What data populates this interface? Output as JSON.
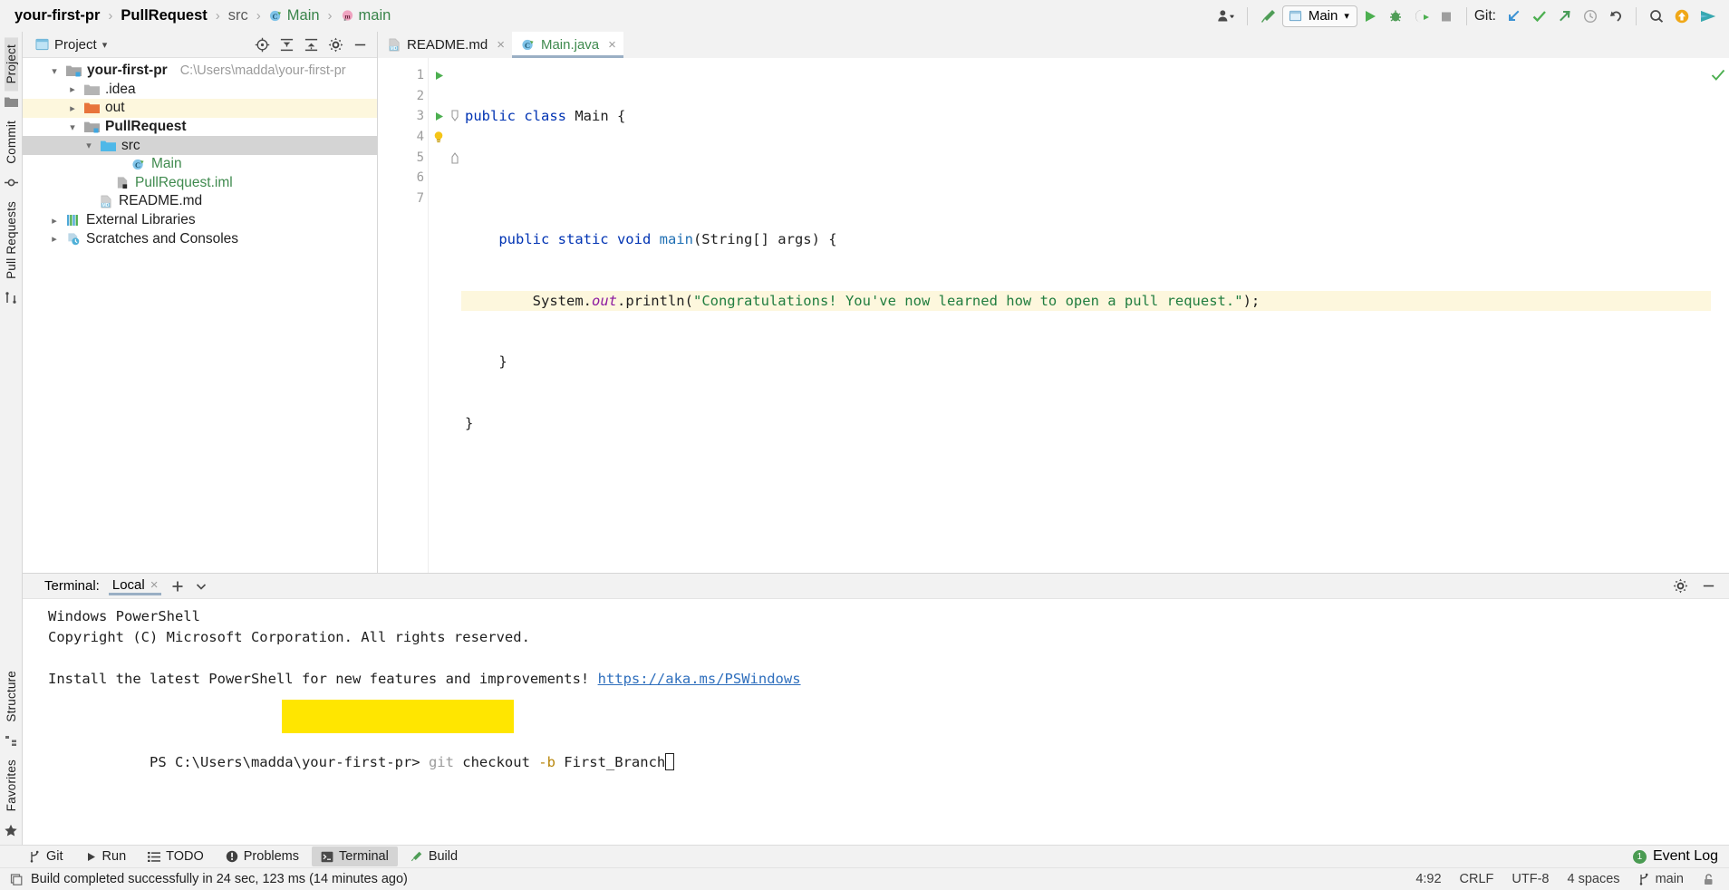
{
  "breadcrumb": {
    "items": [
      {
        "label": "your-first-pr",
        "style": "bold"
      },
      {
        "label": "PullRequest",
        "style": "bold"
      },
      {
        "label": "src",
        "style": "grey"
      },
      {
        "label": "Main",
        "style": "green",
        "icon": "java-class-icon"
      },
      {
        "label": "main",
        "style": "green",
        "icon": "java-method-icon"
      }
    ],
    "separator": "›"
  },
  "toolbar": {
    "account_icon": "user-account-icon",
    "build_icon": "build-hammer-icon",
    "run_config": {
      "label": "Main",
      "icon": "run-config-icon",
      "chevron": "▾"
    },
    "run_icon": "run-play-icon",
    "debug_icon": "debug-bug-icon",
    "run_coverage_icon": "run-with-coverage-icon",
    "stop_icon": "stop-icon",
    "git_label": "Git:",
    "update_project_icon": "git-update-arrow-icon",
    "commit_icon": "git-commit-check-icon",
    "push_icon": "git-push-arrow-icon",
    "history_icon": "git-history-clock-icon",
    "rollback_icon": "git-rollback-undo-icon",
    "search_icon": "search-everywhere-icon",
    "updates_icon": "ide-update-icon",
    "play_services_icon": "run-anything-icon"
  },
  "left_strip": {
    "tabs": [
      {
        "label": "Project",
        "active": true,
        "icon": "project-icon"
      },
      {
        "label": "Commit",
        "active": false,
        "icon": "commit-icon"
      },
      {
        "label": "Pull Requests",
        "active": false,
        "icon": "pull-requests-icon"
      }
    ],
    "bottom_tabs": [
      {
        "label": "Structure",
        "icon": "structure-icon"
      },
      {
        "label": "Favorites",
        "icon": "favorites-star-icon"
      }
    ]
  },
  "project_panel": {
    "title": "Project",
    "title_icon": "project-window-icon",
    "chevron": "▾",
    "tools": [
      {
        "name": "select-opened-file-icon"
      },
      {
        "name": "expand-all-icon"
      },
      {
        "name": "collapse-all-icon"
      },
      {
        "name": "settings-gear-icon"
      },
      {
        "name": "hide-panel-icon"
      }
    ],
    "tree": [
      {
        "label": "your-first-pr",
        "path": "C:\\Users\\madda\\your-first-pr",
        "depth": 0,
        "arrow": "down",
        "icon": "module-folder-icon",
        "bold": true,
        "state": "normal"
      },
      {
        "label": ".idea",
        "path": "",
        "depth": 1,
        "arrow": "right",
        "icon": "folder-grey-icon",
        "bold": false,
        "state": "normal"
      },
      {
        "label": "out",
        "path": "",
        "depth": 1,
        "arrow": "right",
        "icon": "folder-orange-icon",
        "bold": false,
        "state": "highlight"
      },
      {
        "label": "PullRequest",
        "path": "",
        "depth": 1,
        "arrow": "down",
        "icon": "module-folder-icon",
        "bold": true,
        "state": "normal"
      },
      {
        "label": "src",
        "path": "",
        "depth": 2,
        "arrow": "down",
        "icon": "folder-blue-icon",
        "bold": false,
        "state": "selected"
      },
      {
        "label": "Main",
        "path": "",
        "depth": 3,
        "arrow": "none",
        "icon": "java-class-icon",
        "bold": false,
        "state": "normal",
        "green": true
      },
      {
        "label": "PullRequest.iml",
        "path": "",
        "depth": 2,
        "arrow": "none",
        "icon": "iml-file-icon",
        "bold": false,
        "state": "normal",
        "green": true
      },
      {
        "label": "README.md",
        "path": "",
        "depth": 1,
        "arrow": "none",
        "icon": "markdown-file-icon",
        "bold": false,
        "state": "normal"
      },
      {
        "label": "External Libraries",
        "path": "",
        "depth": 0,
        "arrow": "right",
        "icon": "external-libraries-icon",
        "bold": false,
        "state": "normal"
      },
      {
        "label": "Scratches and Consoles",
        "path": "",
        "depth": 0,
        "arrow": "right",
        "icon": "scratches-icon",
        "bold": false,
        "state": "normal"
      }
    ]
  },
  "editor": {
    "tabs": [
      {
        "label": "README.md",
        "icon": "markdown-file-icon",
        "active": false,
        "close": "×",
        "green": false
      },
      {
        "label": "Main.java",
        "icon": "java-class-icon",
        "active": true,
        "close": "×",
        "green": true
      }
    ],
    "lines": [
      {
        "num": "1",
        "gutter_icon": "run-gutter-icon",
        "fold": "none",
        "highlight": false,
        "tokens": [
          {
            "t": "public ",
            "c": "kw"
          },
          {
            "t": "class ",
            "c": "kw"
          },
          {
            "t": "Main {",
            "c": "pl"
          }
        ]
      },
      {
        "num": "2",
        "gutter_icon": "none",
        "fold": "none",
        "highlight": false,
        "tokens": []
      },
      {
        "num": "3",
        "gutter_icon": "run-gutter-icon",
        "fold": "start",
        "highlight": false,
        "tokens": [
          {
            "t": "    public static void ",
            "c": "kw"
          },
          {
            "t": "main",
            "c": "tp"
          },
          {
            "t": "(String[] args) {",
            "c": "pl"
          }
        ]
      },
      {
        "num": "4",
        "gutter_icon": "intention-bulb-icon",
        "fold": "none",
        "highlight": true,
        "tokens": [
          {
            "t": "        System.",
            "c": "pl"
          },
          {
            "t": "out",
            "c": "fd"
          },
          {
            "t": ".println(",
            "c": "pl"
          },
          {
            "t": "\"Congratulations! You've now learned how to open a pull request.\"",
            "c": "st"
          },
          {
            "t": ");",
            "c": "pl"
          }
        ]
      },
      {
        "num": "5",
        "gutter_icon": "none",
        "fold": "end",
        "highlight": false,
        "tokens": [
          {
            "t": "    }",
            "c": "pl"
          }
        ]
      },
      {
        "num": "6",
        "gutter_icon": "none",
        "fold": "none",
        "highlight": false,
        "tokens": [
          {
            "t": "}",
            "c": "pl"
          }
        ]
      },
      {
        "num": "7",
        "gutter_icon": "none",
        "fold": "none",
        "highlight": false,
        "tokens": []
      }
    ],
    "inspection_status_icon": "inspections-ok-check-icon"
  },
  "terminal": {
    "label": "Terminal:",
    "tab_label": "Local",
    "tab_close": "×",
    "add_icon": "add-terminal-tab-icon",
    "chevron_icon": "terminal-tabs-dropdown-icon",
    "settings_icon": "settings-gear-icon",
    "hide_icon": "hide-panel-icon",
    "lines": [
      "Windows PowerShell",
      "Copyright (C) Microsoft Corporation. All rights reserved.",
      "",
      "Install the latest PowerShell for new features and improvements!"
    ],
    "link_text": "https://aka.ms/PSWindows",
    "prompt": "PS C:\\Users\\madda\\your-first-pr>",
    "command_dim": " git",
    "command": " checkout ",
    "command_flag": "-b",
    "command_arg": " First_Branch",
    "highlight_color": "#ffe600"
  },
  "bottom_bar": {
    "buttons": [
      {
        "label": "Git",
        "icon": "git-branch-icon",
        "active": false
      },
      {
        "label": "Run",
        "icon": "run-play-icon",
        "active": false
      },
      {
        "label": "TODO",
        "icon": "todo-list-icon",
        "active": false
      },
      {
        "label": "Problems",
        "icon": "problems-icon",
        "active": false
      },
      {
        "label": "Terminal",
        "icon": "terminal-icon",
        "active": true
      },
      {
        "label": "Build",
        "icon": "build-hammer-icon",
        "active": false
      }
    ],
    "event_log": {
      "label": "Event Log",
      "count": "1",
      "badge_color": "#4a9b52"
    }
  },
  "status_bar": {
    "message": "Build completed successfully in 24 sec, 123 ms (14 minutes ago)",
    "message_icon": "build-status-icon",
    "caret": "4:92",
    "line_separator": "CRLF",
    "encoding": "UTF-8",
    "indent": "4 spaces",
    "branch": "main",
    "branch_icon": "git-branch-icon",
    "lock_icon": "read-write-lock-icon"
  }
}
